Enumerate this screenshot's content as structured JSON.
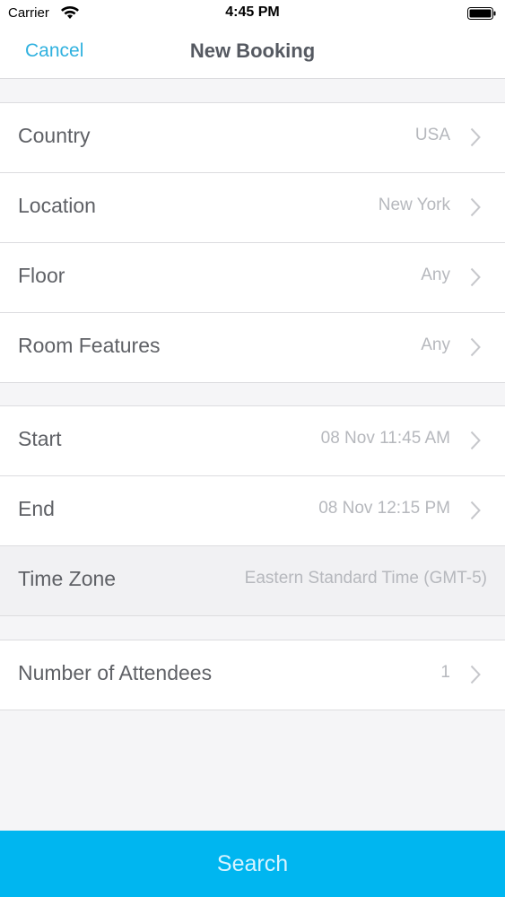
{
  "status_bar": {
    "carrier": "Carrier",
    "time": "4:45 PM"
  },
  "nav": {
    "cancel_label": "Cancel",
    "title": "New Booking"
  },
  "group1": [
    {
      "label": "Country",
      "value": "USA"
    },
    {
      "label": "Location",
      "value": "New York"
    },
    {
      "label": "Floor",
      "value": "Any"
    },
    {
      "label": "Room Features",
      "value": "Any"
    }
  ],
  "group2": [
    {
      "label": "Start",
      "value": "08 Nov 11:45 AM"
    },
    {
      "label": "End",
      "value": "08 Nov 12:15 PM"
    },
    {
      "label": "Time Zone",
      "value": "Eastern Standard Time (GMT-5)"
    }
  ],
  "group3": [
    {
      "label": "Number of Attendees",
      "value": "1"
    }
  ],
  "search_label": "Search",
  "colors": {
    "accent": "#2fb1df",
    "search_bg": "#00b6f0",
    "value_text": "#b6b8bd",
    "label_text": "#5f6166"
  }
}
